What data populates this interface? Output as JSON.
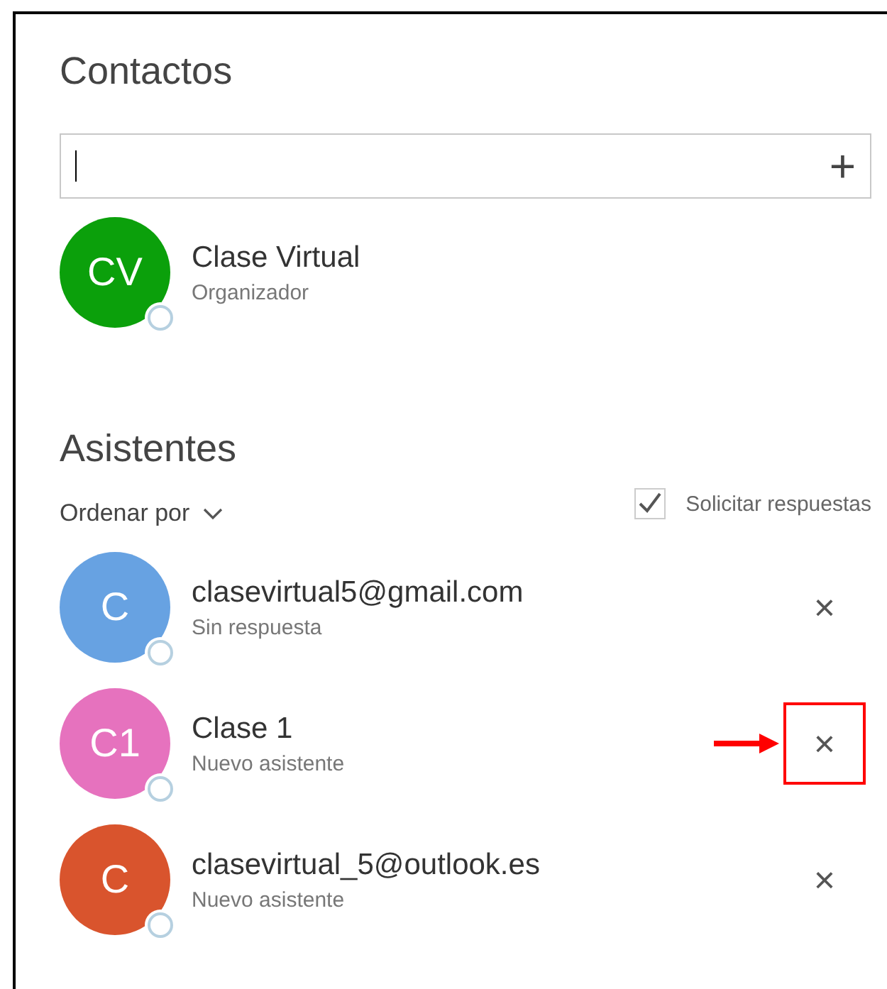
{
  "contacts": {
    "title": "Contactos",
    "add_field": {
      "add_icon": "+"
    },
    "organizer": {
      "initials": "CV",
      "color": "#0ba00b",
      "name": "Clase Virtual",
      "role": "Organizador"
    }
  },
  "attendees": {
    "title": "Asistentes",
    "sort": {
      "label": "Ordenar por"
    },
    "request_responses": {
      "label": "Solicitar respuestas",
      "checked": true
    },
    "items": [
      {
        "initials": "C",
        "color": "#67a2e2",
        "name": "clasevirtual5@gmail.com",
        "status": "Sin respuesta",
        "remove_icon": "×",
        "highlighted": false
      },
      {
        "initials": "C1",
        "color": "#e672be",
        "name": "Clase 1",
        "status": "Nuevo asistente",
        "remove_icon": "×",
        "highlighted": true
      },
      {
        "initials": "C",
        "color": "#d9542d",
        "name": "clasevirtual_5@outlook.es",
        "status": "Nuevo asistente",
        "remove_icon": "×",
        "highlighted": false
      }
    ]
  }
}
